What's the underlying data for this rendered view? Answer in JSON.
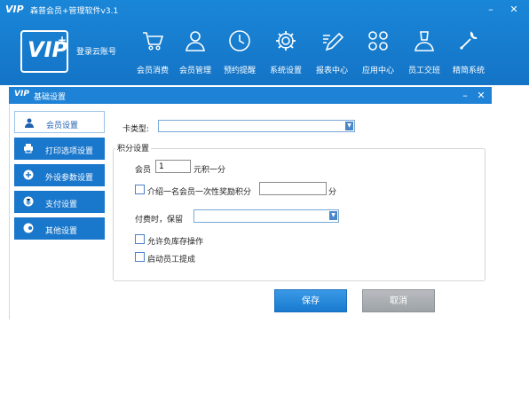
{
  "titlebar": {
    "logo": "VIP",
    "title": "森普会员+管理软件v3.1",
    "minimize": "–",
    "close": "✕"
  },
  "header": {
    "logo_text": "VIP",
    "logo_plus": "+",
    "login_label": "登录云账号",
    "nav": [
      {
        "label": "会员消费",
        "icon": "cart-icon"
      },
      {
        "label": "会员管理",
        "icon": "user-icon"
      },
      {
        "label": "预约提醒",
        "icon": "clock-icon"
      },
      {
        "label": "系统设置",
        "icon": "gear-icon"
      },
      {
        "label": "报表中心",
        "icon": "pen-icon"
      },
      {
        "label": "应用中心",
        "icon": "grid-icon"
      },
      {
        "label": "员工交班",
        "icon": "person-icon"
      },
      {
        "label": "精简系统",
        "icon": "wrench-icon"
      }
    ]
  },
  "dialog": {
    "logo": "VIP",
    "title": "基础设置",
    "minimize": "–",
    "close": "✕",
    "sidebar": [
      {
        "label": "会员设置",
        "icon": "person-icon",
        "active": true
      },
      {
        "label": "打印选项设置",
        "icon": "printer-icon",
        "active": false
      },
      {
        "label": "外设参数设置",
        "icon": "device-icon",
        "active": false
      },
      {
        "label": "支付设置",
        "icon": "payment-icon",
        "active": false
      },
      {
        "label": "其他设置",
        "icon": "other-icon",
        "active": false
      }
    ],
    "form": {
      "card_type_label": "卡类型:",
      "card_type_value": "",
      "points_group_label": "积分设置",
      "member_label": "会员",
      "member_value": "1",
      "member_suffix": "元积一分",
      "referral_label": "介绍一名会员一次性奖励积分",
      "referral_value": "",
      "referral_suffix": "分",
      "reserve_label": "付费时，保留",
      "reserve_value": "",
      "allow_negative_label": "允许负库存操作",
      "allow_negative_checked": false,
      "staff_commission_label": "启动员工提成",
      "staff_commission_checked": false,
      "referral_checked": false
    },
    "buttons": {
      "save": "保存",
      "cancel": "取消"
    }
  },
  "colors": {
    "header_blue": "#1a86d8",
    "sidebar_blue": "#1977cc",
    "save_blue": "#1979cf",
    "cancel_gray": "#9ea3a8"
  }
}
